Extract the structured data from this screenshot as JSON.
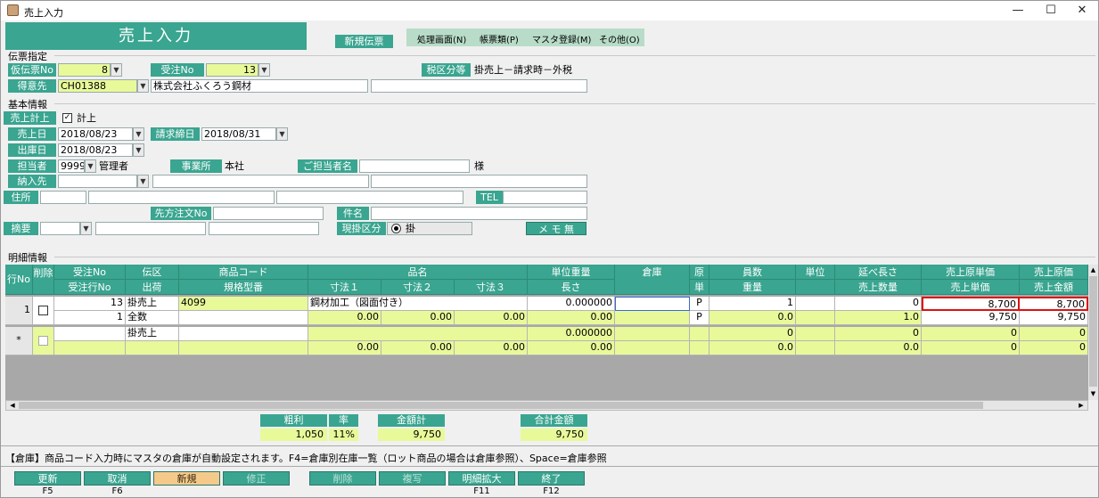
{
  "window": {
    "title": "売上入力",
    "min": "—",
    "max": "☐",
    "close": "✕"
  },
  "banner": "売上入力",
  "new_slip": "新規伝票",
  "menu": [
    "処理画面(N)",
    "帳票類(P)",
    "マスタ登録(M)",
    "その他(O)"
  ],
  "sections": {
    "slip": "伝票指定",
    "basic": "基本情報",
    "detail": "明細情報"
  },
  "slip": {
    "temp_no_label": "仮伝票No",
    "temp_no": "8",
    "order_no_label": "受注No",
    "order_no": "13",
    "tax_label": "税区分等",
    "tax_value": "掛売上－請求時－外税",
    "customer_label": "得意先",
    "customer_code": "CH01388",
    "customer_name": "株式会社ふくろう鋼材"
  },
  "basic": {
    "sales_post_label": "売上計上",
    "sales_post_check": "計上",
    "sales_date_label": "売上日",
    "sales_date": "2018/08/23",
    "billing_close_label": "請求締日",
    "billing_close": "2018/08/31",
    "ship_date_label": "出庫日",
    "ship_date": "2018/08/23",
    "staff_label": "担当者",
    "staff_code": "9999",
    "staff_name": "管理者",
    "office_label": "事業所",
    "office_value": "本社",
    "contact_label": "ご担当者名",
    "contact_suffix": "様",
    "delivery_label": "納入先",
    "address_label": "住所",
    "tel_label": "TEL",
    "cust_order_label": "先方注文No",
    "subject_label": "件名",
    "memo_label": "摘要",
    "cash_credit_label": "現掛区分",
    "cash_credit_value": "掛",
    "memo_button": "メ モ 無"
  },
  "grid": {
    "header_top": [
      "行No",
      "削除",
      "受注No",
      "伝区",
      "商品コード",
      "品名",
      "単位重量",
      "倉庫",
      "原",
      "員数",
      "単位",
      "延べ長さ",
      "売上原単価",
      "売上原価"
    ],
    "header_bottom": [
      "受注行No",
      "出荷",
      "規格型番",
      "寸法１",
      "寸法２",
      "寸法３",
      "長さ",
      "単",
      "重量",
      "売上数量",
      "売上単価",
      "売上金額"
    ],
    "row1": {
      "no": "1",
      "order_no": "13",
      "type": "掛売上",
      "product_code": "4099",
      "product_name": "鋼材加工（図面付き）",
      "unit_weight": "0.000000",
      "gen": "P",
      "qty": "1",
      "total_length": "0",
      "cost_unit": "8,700",
      "cost": "8,700",
      "order_line": "1",
      "ship": "全数",
      "dim1": "0.00",
      "dim2": "0.00",
      "dim3": "0.00",
      "length": "0.00",
      "tan": "P",
      "weight": "0.0",
      "sales_qty": "1.0",
      "sales_unit": "9,750",
      "sales_amount": "9,750"
    },
    "row_new": {
      "no": "*",
      "type": "掛売上",
      "unit_weight": "0.000000",
      "qty": "0",
      "total_length": "0",
      "cost_unit": "0",
      "cost": "0",
      "dim1": "0.00",
      "dim2": "0.00",
      "dim3": "0.00",
      "length": "0.00",
      "weight": "0.0",
      "sales_qty": "0.0",
      "sales_unit": "0",
      "sales_amount": "0"
    }
  },
  "summary": {
    "gross_label": "粗利",
    "gross": "1,050",
    "rate_label": "率",
    "rate": "11%",
    "total_label": "金額計",
    "total": "9,750",
    "grand_label": "合計金額",
    "grand": "9,750"
  },
  "message": "【倉庫】商品コード入力時にマスタの倉庫が自動設定されます。F4=倉庫別在庫一覧（ロット商品の場合は倉庫参照）、Space=倉庫参照",
  "fkeys": [
    {
      "label": "更新",
      "key": "F5"
    },
    {
      "label": "取消",
      "key": "F6"
    },
    {
      "label": "新規",
      "key": ""
    },
    {
      "label": "修正",
      "key": ""
    },
    {
      "label": "削除",
      "key": ""
    },
    {
      "label": "複写",
      "key": ""
    },
    {
      "label": "明細拡大",
      "key": "F11"
    },
    {
      "label": "終了",
      "key": "F12"
    }
  ]
}
